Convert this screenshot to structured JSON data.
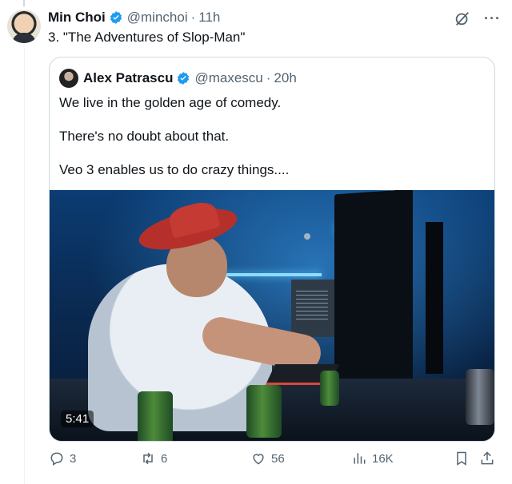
{
  "tweet": {
    "author_name": "Min Choi",
    "handle": "@minchoi",
    "separator": "·",
    "time": "11h",
    "text": "3. \"The Adventures of Slop-Man\""
  },
  "quoted_tweet": {
    "author_name": "Alex Patrascu",
    "handle": "@maxescu",
    "separator": "·",
    "time": "20h",
    "paragraphs": [
      "We live in the golden age of comedy.",
      "There's no doubt about that.",
      "Veo 3 enables us to do crazy things...."
    ],
    "video_duration": "5:41"
  },
  "actions": {
    "replies": "3",
    "reposts": "6",
    "likes": "56",
    "views": "16K"
  },
  "icons": {
    "verified": "verified-badge-icon",
    "grok": "grok-icon",
    "more": "more-icon",
    "reply": "reply-icon",
    "repost": "repost-icon",
    "like": "heart-icon",
    "views": "views-icon",
    "bookmark": "bookmark-icon",
    "share": "share-icon"
  },
  "colors": {
    "verified_blue": "#1d9bf0",
    "secondary_text": "#536471",
    "border": "#cfd9de"
  }
}
